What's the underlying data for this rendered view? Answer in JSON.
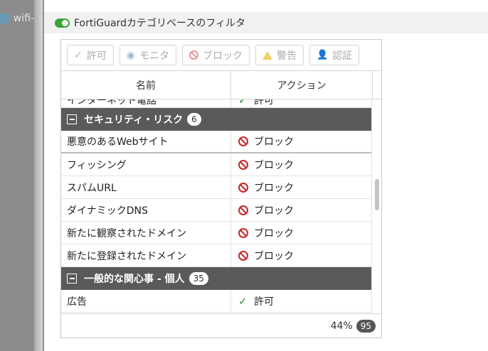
{
  "background": {
    "tab_label": "wifi-"
  },
  "section": {
    "title": "FortiGuardカテゴリベースのフィルタ",
    "enabled": true
  },
  "toolbar": {
    "allow_label": "許可",
    "monitor_label": "モニタ",
    "block_label": "ブロック",
    "warn_label": "警告",
    "auth_label": "認証"
  },
  "table": {
    "columns": {
      "name": "名前",
      "action": "アクション"
    },
    "partial_row": {
      "name": "インターネット電話",
      "action": "許可"
    },
    "groups": [
      {
        "label": "セキュリティ・リスク",
        "count": "6",
        "rows": [
          {
            "name": "悪意のあるWebサイト",
            "action": "ブロック",
            "action_type": "block"
          },
          {
            "name": "フィッシング",
            "action": "ブロック",
            "action_type": "block"
          },
          {
            "name": "スパムURL",
            "action": "ブロック",
            "action_type": "block"
          },
          {
            "name": "ダイナミックDNS",
            "action": "ブロック",
            "action_type": "block"
          },
          {
            "name": "新たに観察されたドメイン",
            "action": "ブロック",
            "action_type": "block"
          },
          {
            "name": "新たに登録されたドメイン",
            "action": "ブロック",
            "action_type": "block"
          }
        ]
      },
      {
        "label": "一般的な関心事 - 個人",
        "count": "35",
        "rows": [
          {
            "name": "広告",
            "action": "許可",
            "action_type": "allow"
          }
        ]
      }
    ]
  },
  "footer": {
    "percent": "44%",
    "total": "95"
  },
  "colors": {
    "accent_green": "#3aa335",
    "block_red": "#c62828",
    "group_header": "#5a5a5a"
  }
}
